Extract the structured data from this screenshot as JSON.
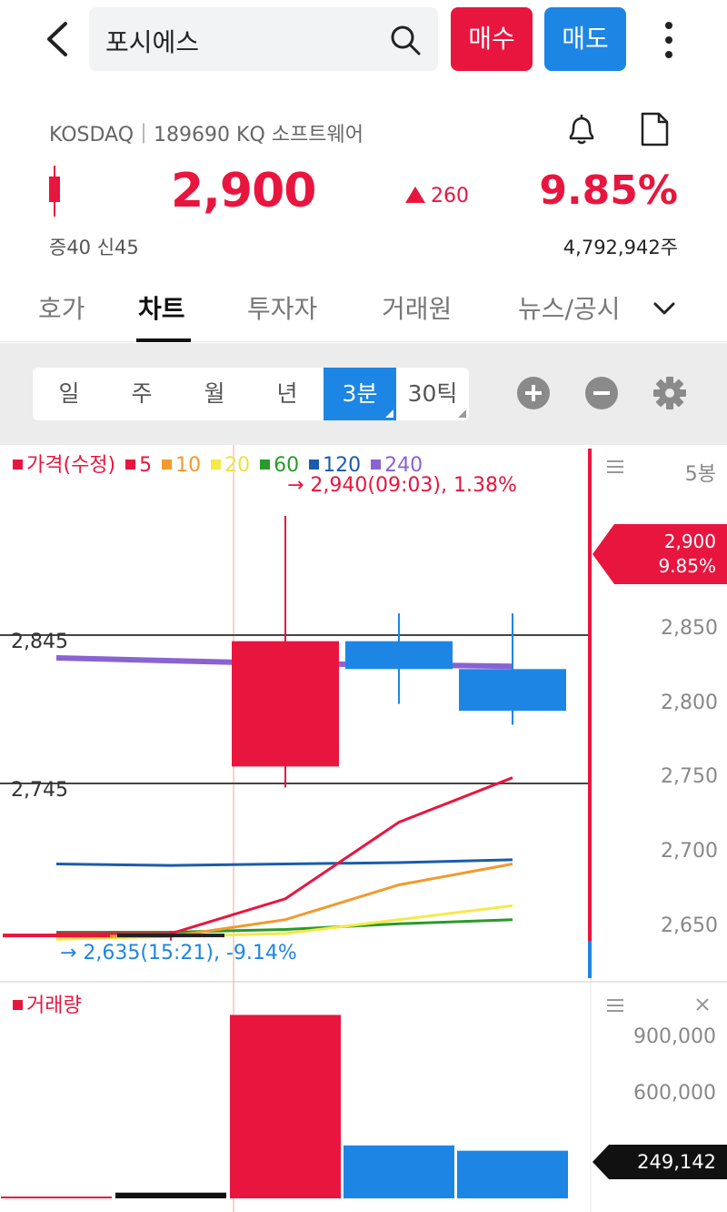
{
  "header": {
    "search_query": "포시에스",
    "buy_label": "매수",
    "sell_label": "매도"
  },
  "quote": {
    "market_line": "KOSDAQ｜189690 KQ 소프트웨어",
    "price": "2,900",
    "change": "260",
    "change_pct": "9.85%",
    "margin_info": "증40  신45",
    "volume": "4,792,942주"
  },
  "tabs": [
    {
      "label": "호가"
    },
    {
      "label": "차트"
    },
    {
      "label": "투자자"
    },
    {
      "label": "거래원"
    },
    {
      "label": "뉴스/공시"
    }
  ],
  "periods": [
    {
      "label": "일"
    },
    {
      "label": "주"
    },
    {
      "label": "월"
    },
    {
      "label": "년"
    },
    {
      "label": "3분"
    },
    {
      "label": "30틱"
    }
  ],
  "colors": {
    "up": "#e8163f",
    "down": "#1d86e4",
    "ma5": "#e8163f",
    "ma10": "#f29a2e",
    "ma20": "#f5e94a",
    "ma60": "#2a9a2a",
    "ma120": "#1a5cab",
    "ma240": "#8a63d2"
  },
  "chart": {
    "legend": [
      {
        "label": "가격(수정)",
        "color": "#e8163f"
      },
      {
        "label": "5",
        "color": "#e8163f"
      },
      {
        "label": "10",
        "color": "#f29a2e"
      },
      {
        "label": "20",
        "color": "#f5e94a"
      },
      {
        "label": "60",
        "color": "#2a9a2a"
      },
      {
        "label": "120",
        "color": "#1a5cab"
      },
      {
        "label": "240",
        "color": "#8a63d2"
      }
    ],
    "high_annot": "→ 2,940(09:03), 1.38%",
    "low_annot": "→ 2,635(15:21), -9.14%",
    "hline_upper": "2,845",
    "hline_lower": "2,745",
    "bars_label": "5봉",
    "price_axis": [
      "2,850",
      "2,800",
      "2,750",
      "2,700",
      "2,650"
    ],
    "current_price": "2,900",
    "current_pct": "9.85%",
    "volume_title": "거래량",
    "volume_axis": [
      "900,000",
      "600,000"
    ],
    "current_volume": "249,142"
  },
  "chart_data": {
    "type": "candlestick",
    "ylim": [
      2625,
      2955
    ],
    "candles": [
      {
        "open": 2640,
        "high": 2640,
        "low": 2640,
        "close": 2640,
        "volume": 5000
      },
      {
        "open": 2640,
        "high": 2642,
        "low": 2635,
        "close": 2640,
        "volume": 30000
      },
      {
        "open": 2760,
        "high": 2940,
        "low": 2745,
        "close": 2850,
        "volume": 960000
      },
      {
        "open": 2850,
        "high": 2870,
        "low": 2805,
        "close": 2830,
        "volume": 277000
      },
      {
        "open": 2830,
        "high": 2870,
        "low": 2790,
        "close": 2800,
        "volume": 249142
      }
    ],
    "ma": {
      "ma5": [
        2640,
        2640,
        2665,
        2720,
        2752
      ],
      "ma10": [
        2638,
        2638,
        2650,
        2675,
        2690
      ],
      "ma20": [
        2636,
        2638,
        2640,
        2650,
        2660
      ],
      "ma60": [
        2641,
        2641,
        2643,
        2647,
        2650
      ],
      "ma120": [
        2690,
        2689,
        2690,
        2691,
        2693
      ],
      "ma240": [
        2838,
        2836,
        2834,
        2833,
        2832
      ]
    }
  }
}
